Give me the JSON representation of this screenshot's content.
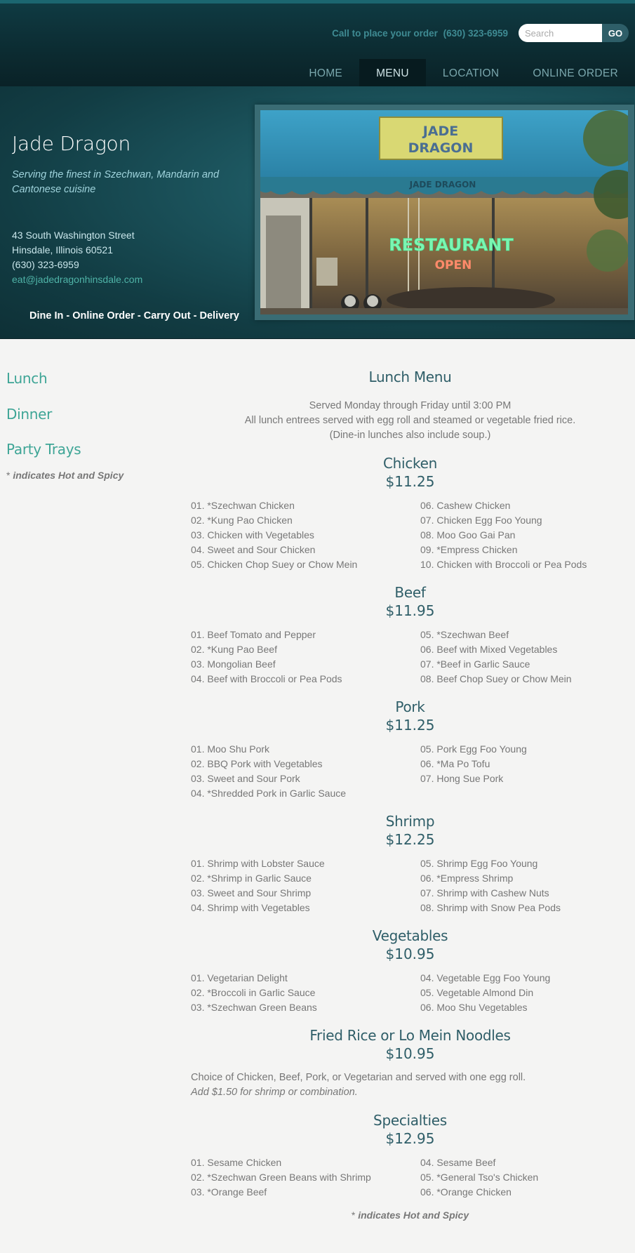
{
  "header": {
    "call_label": "Call to place your order",
    "phone": "(630) 323-6959",
    "search_placeholder": "Search",
    "go_label": "GO",
    "nav": [
      {
        "label": "HOME",
        "active": false
      },
      {
        "label": "MENU",
        "active": true
      },
      {
        "label": "LOCATION",
        "active": false
      },
      {
        "label": "ONLINE ORDER",
        "active": false
      }
    ]
  },
  "hero": {
    "name": "Jade Dragon",
    "tagline": "Serving the finest in Szechwan, Mandarin and Cantonese cuisine",
    "address_line1": "43 South Washington Street",
    "address_line2": "Hinsdale, Illinois 60521",
    "phone": "(630) 323-6959",
    "email": "eat@jadedragonhinsdale.com",
    "services": "Dine In - Online Order - Carry Out - Delivery",
    "photo": {
      "sign_line1": "JADE",
      "sign_line2": "DRAGON",
      "awning_text": "JADE DRAGON",
      "neon_main": "RESTAURANT",
      "neon_sub": "OPEN"
    }
  },
  "sidebar": {
    "links": [
      "Lunch",
      "Dinner",
      "Party Trays"
    ],
    "note_star": "*",
    "note_text": "indicates Hot and Spicy"
  },
  "menu": {
    "title": "Lunch Menu",
    "intro": [
      "Served Monday through Friday until 3:00 PM",
      "All lunch entrees served with egg roll and steamed or vegetable fried rice.",
      "(Dine-in lunches also include soup.)"
    ],
    "sections": [
      {
        "name": "Chicken",
        "price": "$11.25",
        "left": [
          "01. *Szechwan Chicken",
          "02. *Kung Pao Chicken",
          "03. Chicken with Vegetables",
          "04. Sweet and Sour Chicken",
          "05. Chicken Chop Suey or Chow Mein"
        ],
        "right": [
          "06. Cashew Chicken",
          "07. Chicken Egg Foo Young",
          "08. Moo Goo Gai Pan",
          "09. *Empress Chicken",
          "10. Chicken with Broccoli or Pea Pods"
        ]
      },
      {
        "name": "Beef",
        "price": "$11.95",
        "left": [
          "01. Beef Tomato and Pepper",
          "02. *Kung Pao Beef",
          "03. Mongolian Beef",
          "04. Beef with Broccoli or Pea Pods"
        ],
        "right": [
          "05. *Szechwan Beef",
          "06. Beef with Mixed Vegetables",
          "07. *Beef in Garlic Sauce",
          "08. Beef Chop Suey or Chow Mein"
        ]
      },
      {
        "name": "Pork",
        "price": "$11.25",
        "left": [
          "01. Moo Shu Pork",
          "02. BBQ Pork with Vegetables",
          "03. Sweet and Sour Pork",
          "04. *Shredded Pork in Garlic Sauce"
        ],
        "right": [
          "05. Pork Egg Foo Young",
          "06. *Ma Po Tofu",
          "07. Hong Sue Pork"
        ]
      },
      {
        "name": "Shrimp",
        "price": "$12.25",
        "left": [
          "01. Shrimp with Lobster Sauce",
          "02. *Shrimp in Garlic Sauce",
          "03. Sweet and Sour Shrimp",
          "04. Shrimp with Vegetables"
        ],
        "right": [
          "05. Shrimp Egg Foo Young",
          "06. *Empress Shrimp",
          "07. Shrimp with Cashew Nuts",
          "08. Shrimp with Snow Pea Pods"
        ]
      },
      {
        "name": "Vegetables",
        "price": "$10.95",
        "left": [
          "01. Vegetarian Delight",
          "02. *Broccoli in Garlic Sauce",
          "03. *Szechwan Green Beans"
        ],
        "right": [
          "04. Vegetable Egg Foo Young",
          "05. Vegetable Almond Din",
          "06. Moo Shu Vegetables"
        ]
      }
    ],
    "fried_rice": {
      "name": "Fried Rice or Lo Mein Noodles",
      "price": "$10.95",
      "desc": "Choice of Chicken, Beef, Pork, or Vegetarian and served with one egg roll.",
      "note": "Add $1.50 for shrimp or combination."
    },
    "specialties": {
      "name": "Specialties",
      "price": "$12.95",
      "left": [
        "01. Sesame Chicken",
        "02. *Szechwan Green Beans with Shrimp",
        "03. *Orange Beef"
      ],
      "right": [
        "04. Sesame Beef",
        "05. *General Tso's Chicken",
        "06. *Orange Chicken"
      ]
    },
    "footnote_star": "*",
    "footnote_text": "indicates Hot and Spicy"
  }
}
